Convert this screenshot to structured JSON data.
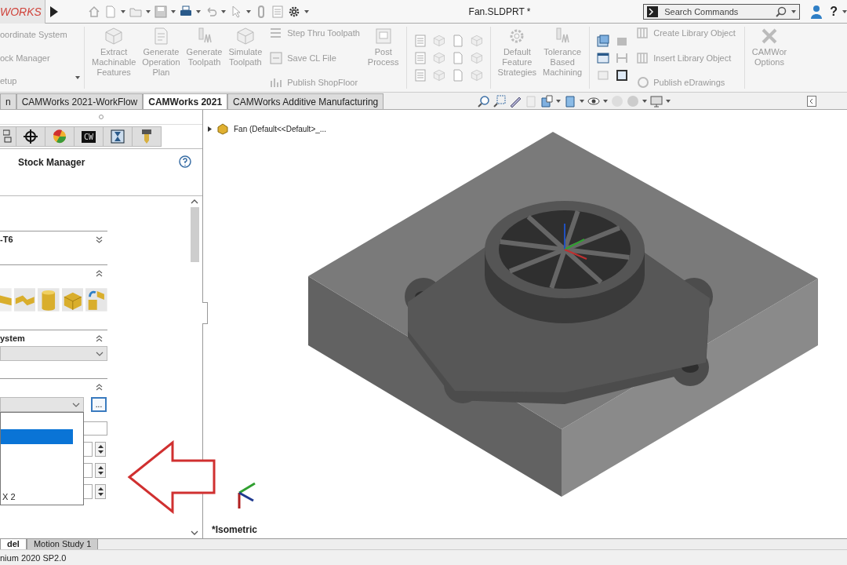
{
  "title_bar": {
    "logo": "WORKS",
    "document_title": "Fan.SLDPRT *",
    "search": {
      "placeholder": "Search Commands"
    },
    "help": "?"
  },
  "ribbon": {
    "menu_items": [
      "oordinate System",
      "ock Manager",
      "etup"
    ],
    "large_buttons": [
      "Extract\nMachinable\nFeatures",
      "Generate\nOperation\nPlan",
      "Generate\nToolpath",
      "Simulate\nToolpath"
    ],
    "small_buttons": [
      "Step Thru Toolpath",
      "Save CL File",
      "Publish ShopFloor"
    ],
    "post_button": "Post\nProcess",
    "strategy_buttons": [
      "Default\nFeature\nStrategies",
      "Tolerance\nBased\nMachining"
    ],
    "library_buttons": [
      "Create Library Object",
      "Insert Library Object",
      "Publish eDrawings"
    ],
    "options_button": "CAMWor\nOptions"
  },
  "tabs": [
    {
      "label": "n",
      "selected": false
    },
    {
      "label": "CAMWorks 2021-WorkFlow",
      "selected": false
    },
    {
      "label": "CAMWorks 2021",
      "selected": true
    },
    {
      "label": "CAMWorks Additive Manufacturing",
      "selected": false
    }
  ],
  "panel": {
    "logo_tab": "CW",
    "title": "Stock Manager",
    "sections": [
      {
        "kind": "text",
        "title": "-T6",
        "expanded": false
      },
      {
        "kind": "stock_types",
        "expanded": true
      },
      {
        "kind": "dropdown",
        "title": "ystem",
        "expanded": true
      },
      {
        "kind": "stock_form",
        "expanded": true,
        "browse_button": "..."
      }
    ],
    "list": [
      {
        "selected": false
      },
      {
        "selected": true
      },
      {
        "selected": false
      },
      {
        "selected": false
      },
      {
        "selected": false
      },
      {
        "label": "X 2",
        "selected": false
      }
    ]
  },
  "tree": {
    "item": "Fan  (Default<<Default>_..."
  },
  "viewport": {
    "view_name": "*Isometric"
  },
  "bottom_tabs": [
    {
      "label": "del",
      "selected": true
    },
    {
      "label": "Motion Study 1",
      "selected": false
    }
  ],
  "status_bar": "nium 2020 SP2.0"
}
